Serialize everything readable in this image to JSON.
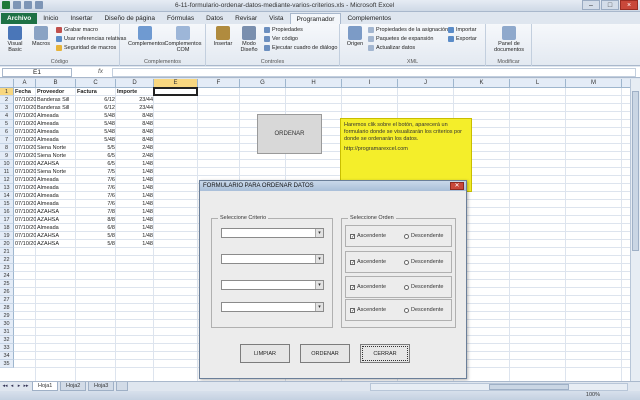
{
  "window": {
    "title": "6-11-formulario-ordenar-datos-mediante-varios-criterios.xls - Microsoft Excel",
    "min": "–",
    "max": "□",
    "close": "×"
  },
  "ribbon_tabs": [
    "Archivo",
    "Inicio",
    "Insertar",
    "Diseño de página",
    "Fórmulas",
    "Datos",
    "Revisar",
    "Vista",
    "Programador",
    "Complementos"
  ],
  "active_tab": "Programador",
  "ribbon": {
    "codigo": {
      "group": "Código",
      "visual_basic": "Visual Basic",
      "macros": "Macros",
      "grabar_macro": "Grabar macro",
      "referencias_relativas": "Usar referencias relativas",
      "seguridad": "Seguridad de macros"
    },
    "complementos": {
      "group": "Complementos",
      "complementos": "Complementos",
      "com": "Complementos COM"
    },
    "controles": {
      "group": "Controles",
      "insertar": "Insertar",
      "modo_diseno": "Modo Diseño",
      "propiedades": "Propiedades",
      "ver_codigo": "Ver código",
      "ejecutar_dialogo": "Ejecutar cuadro de diálogo"
    },
    "xml": {
      "group": "XML",
      "origen": "Origen",
      "propiedades_asignacion": "Propiedades de la asignación",
      "paquetes_expansion": "Paquetes de expansión",
      "actualizar_datos": "Actualizar datos",
      "importar": "Importar",
      "exportar": "Exportar"
    },
    "modificar": {
      "group": "Modificar",
      "panel_documentos": "Panel de documentos"
    }
  },
  "formula_bar": {
    "name_box": "E1",
    "fx": "fx",
    "content": ""
  },
  "grid": {
    "columns": [
      "A",
      "B",
      "C",
      "D",
      "E",
      "F",
      "G",
      "H",
      "I",
      "J",
      "K",
      "L",
      "M",
      "N"
    ],
    "selected_column": "E",
    "selected_row": "1",
    "rows": [
      "1",
      "2",
      "3",
      "4",
      "5",
      "6",
      "7",
      "8",
      "9",
      "10",
      "11",
      "12",
      "13",
      "14",
      "15",
      "16",
      "17",
      "18",
      "19",
      "20",
      "21",
      "22",
      "23",
      "24",
      "25",
      "26",
      "27",
      "28",
      "29",
      "30",
      "31",
      "32",
      "33",
      "34",
      "35"
    ],
    "headers": [
      "Fecha",
      "Proveedor",
      "Factura",
      "Importe"
    ],
    "data": [
      [
        "07/10/2013",
        "Banderas Sill",
        "6/12",
        "23/44"
      ],
      [
        "07/10/2013",
        "Banderas Sill",
        "6/12",
        "23/44"
      ],
      [
        "07/10/2013",
        "Almeada",
        "5/48",
        "8/48"
      ],
      [
        "07/10/2013",
        "Almeada",
        "5/48",
        "8/48"
      ],
      [
        "07/10/2013",
        "Almeada",
        "5/48",
        "8/48"
      ],
      [
        "07/10/2013",
        "Almeada",
        "5/48",
        "8/48"
      ],
      [
        "07/10/2013",
        "Siena Norte",
        "5/5",
        "2/48"
      ],
      [
        "07/10/2013",
        "Siena Norte",
        "6/5",
        "2/48"
      ],
      [
        "07/10/2013",
        "AZAHSA",
        "6/5",
        "1/48"
      ],
      [
        "07/10/2013",
        "Siena Norte",
        "7/5",
        "1/48"
      ],
      [
        "07/10/2013",
        "Almeada",
        "7/6",
        "1/48"
      ],
      [
        "07/10/2013",
        "Almeada",
        "7/6",
        "1/48"
      ],
      [
        "07/10/2013",
        "Almeada",
        "7/6",
        "1/48"
      ],
      [
        "07/10/2013",
        "Almeada",
        "7/6",
        "1/48"
      ],
      [
        "07/10/2013",
        "AZAHSA",
        "7/8",
        "1/48"
      ],
      [
        "07/10/2013",
        "AZAHSA",
        "8/8",
        "1/48"
      ],
      [
        "07/10/2013",
        "Almeada",
        "6/8",
        "1/48"
      ],
      [
        "07/10/2013",
        "AZAHSA",
        "5/8",
        "1/48"
      ],
      [
        "07/10/2013",
        "AZAHSA",
        "5/8",
        "1/48"
      ]
    ]
  },
  "sheet_button": {
    "label": "ORDENAR"
  },
  "note": {
    "text": "Haremos clik sobre el botón, aparecerá un formulario donde se visualizarán los criterios por donde se ordenarán los datos.",
    "url": "http://programarexcel.com"
  },
  "dialog": {
    "title": "FORMULARIO PARA ORDENAR DATOS",
    "close": "✕",
    "frame_left_label": "Seleccione Criterio",
    "frame_right_label": "Seleccione Orden",
    "order_rows": [
      {
        "asc": "Ascendente",
        "desc": "Descendente",
        "asc_checked": "✓"
      },
      {
        "asc": "Ascendente",
        "desc": "Descendente",
        "asc_checked": "✓"
      },
      {
        "asc": "Ascendente",
        "desc": "Descendente",
        "asc_checked": "✓"
      },
      {
        "asc": "Ascendente",
        "desc": "Descendente",
        "asc_checked": "✓"
      }
    ],
    "combo_arrow": "▾",
    "btn_limpiar": "LIMPIAR",
    "btn_ordenar": "ORDENAR",
    "btn_cerrar": "CERRAR"
  },
  "sheet_tabs": [
    "Hoja1",
    "Hoja2",
    "Hoja3"
  ],
  "active_sheet": "Hoja1",
  "nav": [
    "◂◂",
    "◂",
    "▸",
    "▸▸"
  ],
  "status": {
    "zoom": "100%"
  }
}
